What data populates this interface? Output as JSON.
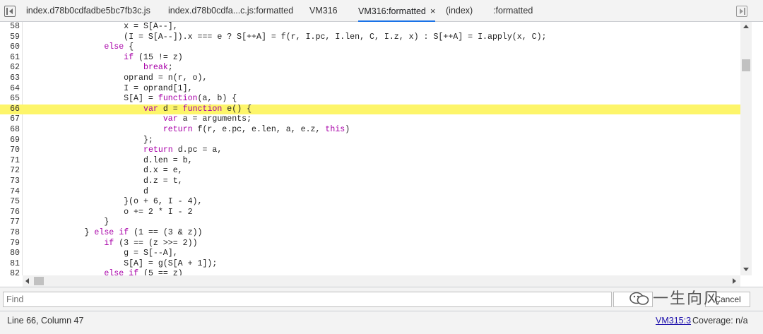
{
  "tabs": [
    {
      "label": "index.d78b0cdfadbe5bc7fb3c.js",
      "active": false
    },
    {
      "label": "index.d78b0cdfa...c.js:formatted",
      "active": false
    },
    {
      "label": "VM316",
      "active": false
    },
    {
      "label": "VM316:formatted",
      "active": true,
      "close": "×"
    },
    {
      "label": "(index)",
      "active": false
    },
    {
      "label": ":formatted",
      "active": false
    }
  ],
  "code_lines": [
    {
      "n": "58",
      "text": "                    x = S[A--],"
    },
    {
      "n": "59",
      "text": "                    (I = S[A--]).x === e ? S[++A] = f(r, I.pc, I.len, C, I.z, x) : S[++A] = I.apply(x, C);"
    },
    {
      "n": "60",
      "text": "                else {"
    },
    {
      "n": "61",
      "text": "                    if (15 != z)"
    },
    {
      "n": "62",
      "text": "                        break;"
    },
    {
      "n": "63",
      "text": "                    oprand = n(r, o),"
    },
    {
      "n": "64",
      "text": "                    I = oprand[1],"
    },
    {
      "n": "65",
      "text": "                    S[A] = function(a, b) {"
    },
    {
      "n": "66",
      "text": "                        var d = function e() {",
      "highlight": true
    },
    {
      "n": "67",
      "text": "                            var a = arguments;"
    },
    {
      "n": "68",
      "text": "                            return f(r, e.pc, e.len, a, e.z, this)"
    },
    {
      "n": "69",
      "text": "                        };"
    },
    {
      "n": "70",
      "text": "                        return d.pc = a,"
    },
    {
      "n": "71",
      "text": "                        d.len = b,"
    },
    {
      "n": "72",
      "text": "                        d.x = e,"
    },
    {
      "n": "73",
      "text": "                        d.z = t,"
    },
    {
      "n": "74",
      "text": "                        d"
    },
    {
      "n": "75",
      "text": "                    }(o + 6, I - 4),"
    },
    {
      "n": "76",
      "text": "                    o += 2 * I - 2"
    },
    {
      "n": "77",
      "text": "                }"
    },
    {
      "n": "78",
      "text": "            } else if (1 == (3 & z))"
    },
    {
      "n": "79",
      "text": "                if (3 == (z >>= 2))"
    },
    {
      "n": "80",
      "text": "                    g = S[--A],"
    },
    {
      "n": "81",
      "text": "                    S[A] = g(S[A + 1]);"
    },
    {
      "n": "82",
      "text": "                else if (5 == z)"
    }
  ],
  "find": {
    "placeholder": "Find",
    "cancel_label": "Cancel"
  },
  "watermark": {
    "text": "一生向风"
  },
  "status": {
    "position": "Line 66, Column 47",
    "source_link": "VM315:3",
    "coverage": "Coverage: n/a"
  },
  "colors": {
    "highlight_line": "#fdf56a",
    "keyword": "#a800a8",
    "active_tab_underline": "#1a73e8"
  }
}
